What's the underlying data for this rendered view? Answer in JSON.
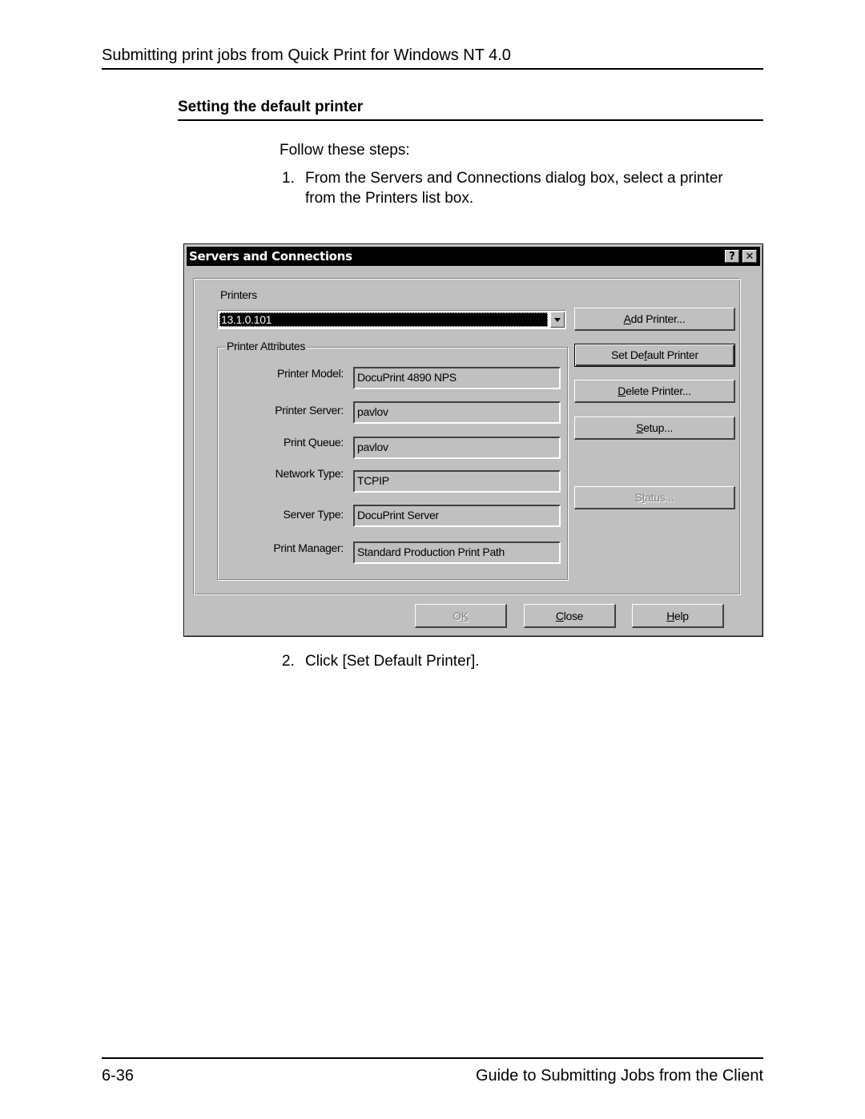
{
  "page": {
    "running_head": "Submitting print jobs from Quick Print for Windows NT 4.0",
    "section_title": "Setting the default printer",
    "intro": "Follow these steps:",
    "steps": [
      {
        "num": "1.",
        "text": "From the Servers and Connections dialog box, select a printer from the Printers list box."
      },
      {
        "num": "2.",
        "text": "Click [Set Default Printer]."
      }
    ],
    "footer": {
      "page_number": "6-36",
      "title": "Guide to Submitting Jobs from the Client"
    }
  },
  "dialog": {
    "title": "Servers and Connections",
    "titlebar_buttons": {
      "help": "?",
      "close": "✕"
    },
    "printers_label": "Printers",
    "printers_selected": "13.1.0.101",
    "attributes_group": "Printer Attributes",
    "fields": [
      {
        "label": "Printer Model:",
        "value": "DocuPrint 4890 NPS"
      },
      {
        "label": "Printer Server:",
        "value": "pavlov"
      },
      {
        "label": "Print Queue:",
        "value": "pavlov"
      },
      {
        "label": "Network Type:",
        "value": "TCPIP"
      },
      {
        "label": "Server Type:",
        "value": "DocuPrint Server"
      },
      {
        "label": "Print Manager:",
        "value": "Standard Production Print Path"
      }
    ],
    "side_buttons": {
      "add": {
        "pre": "",
        "key": "A",
        "post": "dd Printer..."
      },
      "set_default": {
        "pre": "Set De",
        "key": "f",
        "post": "ault Printer"
      },
      "delete": {
        "pre": "",
        "key": "D",
        "post": "elete Printer..."
      },
      "setup": {
        "pre": "",
        "key": "S",
        "post": "etup..."
      },
      "status": {
        "pre": "S",
        "key": "t",
        "post": "atus..."
      }
    },
    "footer_buttons": {
      "ok": {
        "pre": "O",
        "key": "K",
        "post": ""
      },
      "close": {
        "pre": "",
        "key": "C",
        "post": "lose"
      },
      "help": {
        "pre": "",
        "key": "H",
        "post": "elp"
      }
    }
  }
}
